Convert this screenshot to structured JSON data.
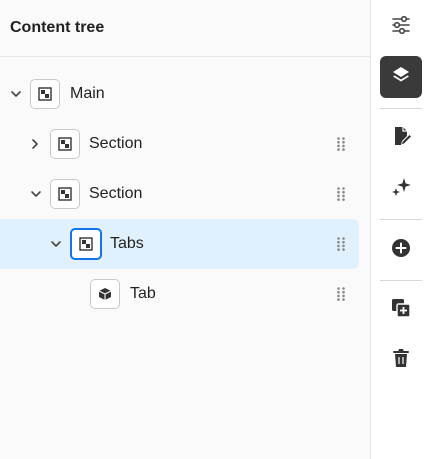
{
  "panel": {
    "title": "Content tree"
  },
  "tree": [
    {
      "label": "Main",
      "icon": "container-icon",
      "expanded": true,
      "depth": 0
    },
    {
      "label": "Section",
      "icon": "container-icon",
      "expanded": false,
      "depth": 1
    },
    {
      "label": "Section",
      "icon": "container-icon",
      "expanded": true,
      "depth": 1
    },
    {
      "label": "Tabs",
      "icon": "container-icon",
      "expanded": true,
      "depth": 2,
      "selected": true
    },
    {
      "label": "Tab",
      "icon": "component-cube-icon",
      "depth": 3
    }
  ],
  "rail": {
    "items": [
      {
        "icon": "properties-sliders-icon"
      },
      {
        "icon": "layers-icon",
        "active": true
      },
      {
        "icon": "edit-document-icon"
      },
      {
        "icon": "sparkles-icon"
      },
      {
        "icon": "add-circle-icon"
      },
      {
        "icon": "duplicate-icon"
      },
      {
        "icon": "delete-trash-icon"
      }
    ]
  },
  "colors": {
    "selection": "#e1f0fd",
    "accent": "#1473e6",
    "active_rail": "#3a3a3a"
  }
}
